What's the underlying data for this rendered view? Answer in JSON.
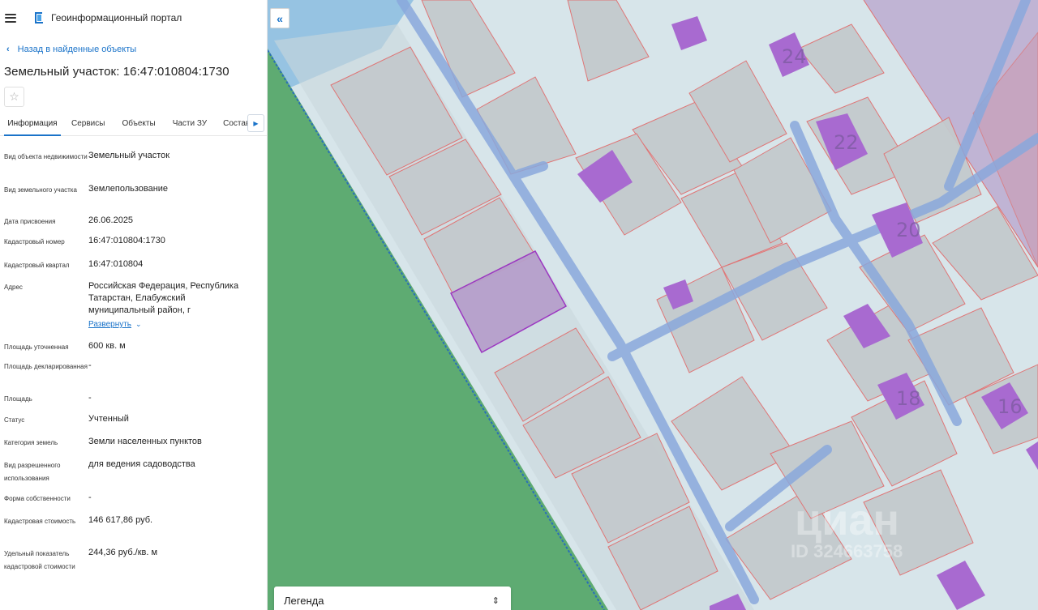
{
  "header": {
    "app_title": "Геоинформационный портал"
  },
  "nav": {
    "back_label": "Назад в найденные объекты"
  },
  "object": {
    "title": "Земельный участок: 16:47:010804:1730"
  },
  "tabs": [
    {
      "label": "Информация"
    },
    {
      "label": "Сервисы"
    },
    {
      "label": "Объекты"
    },
    {
      "label": "Части ЗУ"
    },
    {
      "label": "Состав"
    }
  ],
  "fields": [
    {
      "label": "Вид объекта недвижимости",
      "value": "Земельный участок"
    },
    {
      "label": "Вид земельного участка",
      "value": "Землепользование"
    },
    {
      "label": "Дата присвоения",
      "value": "26.06.2025"
    },
    {
      "label": "Кадастровый номер",
      "value": "16:47:010804:1730"
    },
    {
      "label": "Кадастровый квартал",
      "value": "16:47:010804"
    },
    {
      "label": "Адрес",
      "value": "Российская Федерация, Республика Татарстан, Елабужский муниципальный район, г"
    },
    {
      "label": "Площадь уточненная",
      "value": "600 кв. м"
    },
    {
      "label": "Площадь декларированная",
      "value": "-"
    },
    {
      "label": "Площадь",
      "value": "-"
    },
    {
      "label": "Статус",
      "value": "Учтенный"
    },
    {
      "label": "Категория земель",
      "value": "Земли населенных пунктов"
    },
    {
      "label": "Вид разрешенного использования",
      "value": "для ведения садоводства"
    },
    {
      "label": "Форма собственности",
      "value": "-"
    },
    {
      "label": "Кадастровая стоимость",
      "value": "146 617,86 руб."
    },
    {
      "label": "Удельный показатель кадастровой стоимости",
      "value": "244,36 руб./кв. м"
    }
  ],
  "address_expand_label": "Развернуть",
  "map": {
    "collapse_icon": "«",
    "legend_label": "Легенда",
    "house_numbers": [
      "24",
      "22",
      "20",
      "18",
      "16"
    ],
    "watermark_text": "циан",
    "watermark_id": "ID 324663758",
    "colors": {
      "water": "#8bbde0",
      "forest": "#5eab72",
      "building": "#a86ad0",
      "road": "#8aa8dc",
      "boundary": "#e07070",
      "selected_outline": "#9a30c0",
      "zone": "#b69fcb",
      "accent": "#1a73c9"
    }
  }
}
